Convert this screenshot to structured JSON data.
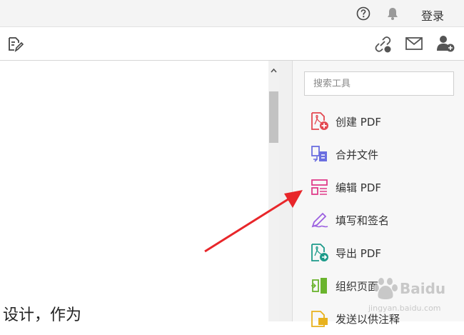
{
  "topbar": {
    "help_icon": "help-circle-icon",
    "bell_icon": "bell-icon",
    "login_label": "登录"
  },
  "toolbar": {
    "left_icon": "fill-sign-icon",
    "right_icons": [
      "link-icon",
      "email-icon",
      "add-user-icon"
    ]
  },
  "document": {
    "visible_text": "设计，作为"
  },
  "right_panel": {
    "search_placeholder": "搜索工具",
    "tools": [
      {
        "label": "创建 PDF",
        "icon": "create-pdf-icon",
        "color": "#e34850"
      },
      {
        "label": "合并文件",
        "icon": "combine-files-icon",
        "color": "#6b6fe0"
      },
      {
        "label": "编辑 PDF",
        "icon": "edit-pdf-icon",
        "color": "#e03c8a"
      },
      {
        "label": "填写和签名",
        "icon": "fill-and-sign-icon",
        "color": "#9b5fe0"
      },
      {
        "label": "导出 PDF",
        "icon": "export-pdf-icon",
        "color": "#1d9b8a"
      },
      {
        "label": "组织页面",
        "icon": "organize-pages-icon",
        "color": "#6ab42d"
      },
      {
        "label": "发送以供注释",
        "icon": "send-for-comments-icon",
        "color": "#e8b11c"
      }
    ]
  },
  "annotation": {
    "arrow_color": "#e8262a"
  },
  "watermark": {
    "brand": "Baidu",
    "url": "jingyan.baidu.com"
  }
}
